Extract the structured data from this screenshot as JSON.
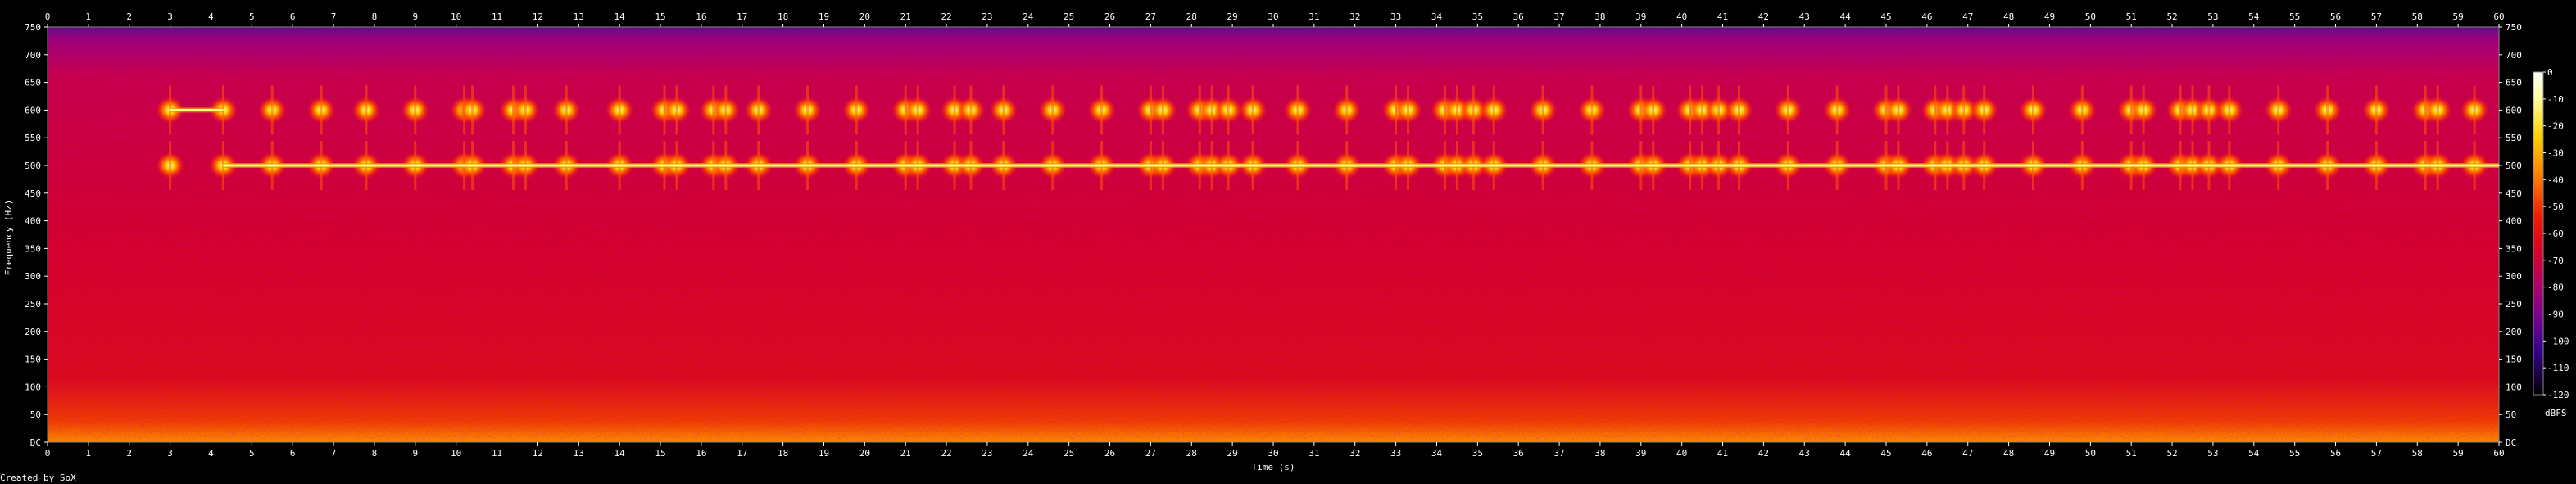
{
  "chart_data": {
    "type": "heatmap",
    "subtype": "spectrogram",
    "xlabel": "Time (s)",
    "ylabel": "Frequency (Hz)",
    "xlim": [
      0,
      60
    ],
    "ylim": [
      0,
      750
    ],
    "x_ticks": [
      0,
      1,
      2,
      3,
      4,
      5,
      6,
      7,
      8,
      9,
      10,
      11,
      12,
      13,
      14,
      15,
      16,
      17,
      18,
      19,
      20,
      21,
      22,
      23,
      24,
      25,
      26,
      27,
      28,
      29,
      30,
      31,
      32,
      33,
      34,
      35,
      36,
      37,
      38,
      39,
      40,
      41,
      42,
      43,
      44,
      45,
      46,
      47,
      48,
      49,
      50,
      51,
      52,
      53,
      54,
      55,
      56,
      57,
      58,
      59,
      60
    ],
    "y_ticks": [
      "DC",
      "50",
      "100",
      "150",
      "200",
      "250",
      "300",
      "350",
      "400",
      "450",
      "500",
      "550",
      "600",
      "650",
      "700",
      "750"
    ],
    "y_tick_values": [
      0,
      50,
      100,
      150,
      200,
      250,
      300,
      350,
      400,
      450,
      500,
      550,
      600,
      650,
      700,
      750
    ],
    "colorbar": {
      "label": "dBFS",
      "ticks": [
        "0",
        "-10",
        "-20",
        "-30",
        "-40",
        "-50",
        "-60",
        "-70",
        "-80",
        "-90",
        "-100",
        "-110",
        "-120"
      ],
      "range": [
        -120,
        0
      ],
      "colors": [
        "#000000",
        "#1a0040",
        "#3a0090",
        "#7a0090",
        "#b0006a",
        "#d8002a",
        "#f01a00",
        "#ff6a00",
        "#ffb000",
        "#ffe840",
        "#ffffd0",
        "#ffffff"
      ]
    },
    "tones": [
      {
        "freq_hz": 600,
        "t_start": 3.0,
        "t_end": 4.3
      },
      {
        "freq_hz": 500,
        "t_start": 4.3,
        "t_end": 60.0
      }
    ],
    "pulse_times": [
      3.0,
      4.3,
      5.5,
      6.7,
      7.8,
      9.0,
      10.2,
      10.4,
      11.4,
      11.7,
      12.7,
      14.0,
      15.1,
      15.4,
      16.3,
      16.6,
      17.4,
      18.6,
      19.8,
      21.0,
      21.3,
      22.2,
      22.6,
      23.4,
      24.6,
      25.8,
      27.0,
      27.3,
      28.2,
      28.5,
      28.9,
      29.5,
      30.6,
      31.8,
      33.0,
      33.3,
      34.2,
      34.5,
      34.9,
      35.4,
      36.6,
      37.8,
      39.0,
      39.3,
      40.2,
      40.5,
      40.9,
      41.4,
      42.6,
      43.8,
      45.0,
      45.3,
      46.2,
      46.5,
      46.9,
      47.4,
      48.6,
      49.8,
      51.0,
      51.3,
      52.2,
      52.5,
      52.9,
      53.4,
      54.6,
      55.8,
      57.0,
      58.2,
      58.5,
      59.4
    ],
    "pulse_freqs_hz": [
      500,
      600
    ],
    "footer": "Created by SoX"
  }
}
